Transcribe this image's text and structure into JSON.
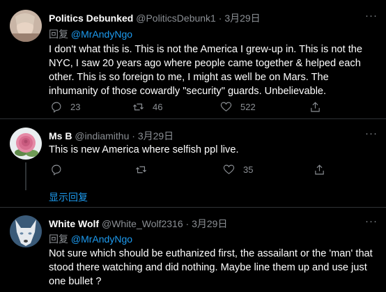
{
  "tweets": [
    {
      "name": "Politics Debunked",
      "handle": "@PoliticsDebunk1",
      "sep": "·",
      "date": "3月29日",
      "reply_label": "回复",
      "reply_to": "@MrAndyNgo",
      "text": "I don't what this is. This is not the America I grew-up in. This is not the NYC, I saw 20 years ago where people came together & helped each other. This is so foreign to me, I might as well be on Mars. The inhumanity of those cowardly \"security\" guards. Unbelievable.",
      "replies": "23",
      "retweets": "46",
      "likes": "522"
    },
    {
      "name": "Ms B",
      "handle": "@indiamithu",
      "sep": "·",
      "date": "3月29日",
      "text": "This is new America where selfish ppl live.",
      "replies": "",
      "retweets": "",
      "likes": "35"
    },
    {
      "name": "White Wolf",
      "handle": "@White_Wolf2316",
      "sep": "·",
      "date": "3月29日",
      "reply_label": "回复",
      "reply_to": "@MrAndyNgo",
      "text": "Not sure which should be euthanized first, the assailant or the 'man' that stood there watching and did nothing. Maybe line them up and use just one bullet ?"
    }
  ],
  "show_replies": "显示回复",
  "more_icon": "···",
  "colors": {
    "accent": "#1d9bf0",
    "muted": "#8b8f94",
    "background": "#000000"
  }
}
